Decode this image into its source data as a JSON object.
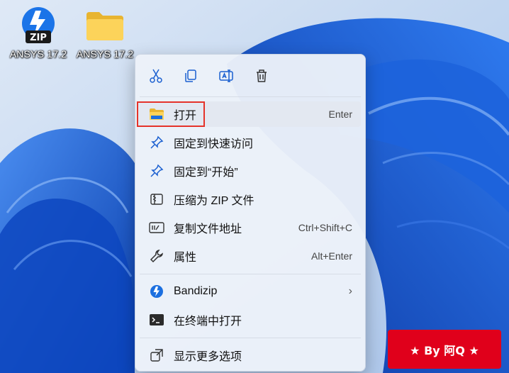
{
  "desktop": {
    "icons": [
      {
        "label": "ANSYS 17.2",
        "icon": "bandizip-zip-file-icon"
      },
      {
        "label": "ANSYS 17.2",
        "icon": "folder-icon"
      }
    ]
  },
  "context_menu": {
    "toolbar": [
      {
        "name": "cut",
        "icon": "scissors-icon"
      },
      {
        "name": "copy",
        "icon": "copy-icon"
      },
      {
        "name": "rename",
        "icon": "rename-icon"
      },
      {
        "name": "delete",
        "icon": "trash-icon"
      }
    ],
    "items": [
      {
        "label": "打开",
        "shortcut": "Enter",
        "icon": "folder-open-icon"
      },
      {
        "label": "固定到快速访问",
        "shortcut": "",
        "icon": "pin-icon"
      },
      {
        "label": "固定到“开始”",
        "shortcut": "",
        "icon": "pin-icon"
      },
      {
        "label": "压缩为 ZIP 文件",
        "shortcut": "",
        "icon": "zip-archive-icon"
      },
      {
        "label": "复制文件地址",
        "shortcut": "Ctrl+Shift+C",
        "icon": "copy-path-icon"
      },
      {
        "label": "属性",
        "shortcut": "Alt+Enter",
        "icon": "wrench-icon"
      },
      {
        "label": "Bandizip",
        "submenu": true,
        "icon": "bandizip-icon"
      },
      {
        "label": "在终端中打开",
        "shortcut": "",
        "icon": "terminal-icon"
      },
      {
        "label": "显示更多选项",
        "shortcut": "",
        "icon": "more-options-icon"
      }
    ]
  },
  "watermark": {
    "text": "★ By 阿Q ★"
  },
  "colors": {
    "highlight_border": "#e5332a",
    "badge_background": "#e0001b",
    "accent_blue": "#1a5fd0"
  }
}
